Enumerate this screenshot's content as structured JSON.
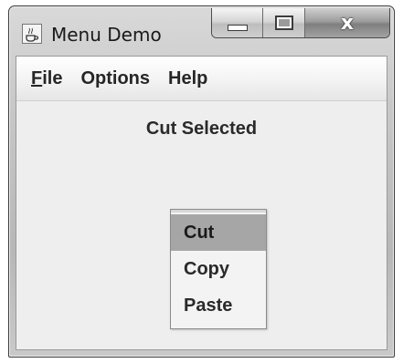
{
  "window": {
    "title": "Menu Demo",
    "icon": "java-cup-icon",
    "controls": {
      "minimize_icon": "minimize-icon",
      "maximize_icon": "maximize-icon",
      "close_glyph": "x"
    }
  },
  "menubar": {
    "items": [
      {
        "label_mnemonic": "F",
        "label_rest": "ile"
      },
      {
        "label": "Options"
      },
      {
        "label": "Help"
      }
    ]
  },
  "status": {
    "text": "Cut Selected"
  },
  "popup_menu": {
    "items": [
      {
        "label": "Cut",
        "selected": true
      },
      {
        "label": "Copy",
        "selected": false
      },
      {
        "label": "Paste",
        "selected": false
      }
    ]
  },
  "colors": {
    "selection": "#a6a6a6",
    "client_background": "#eeeeee"
  }
}
